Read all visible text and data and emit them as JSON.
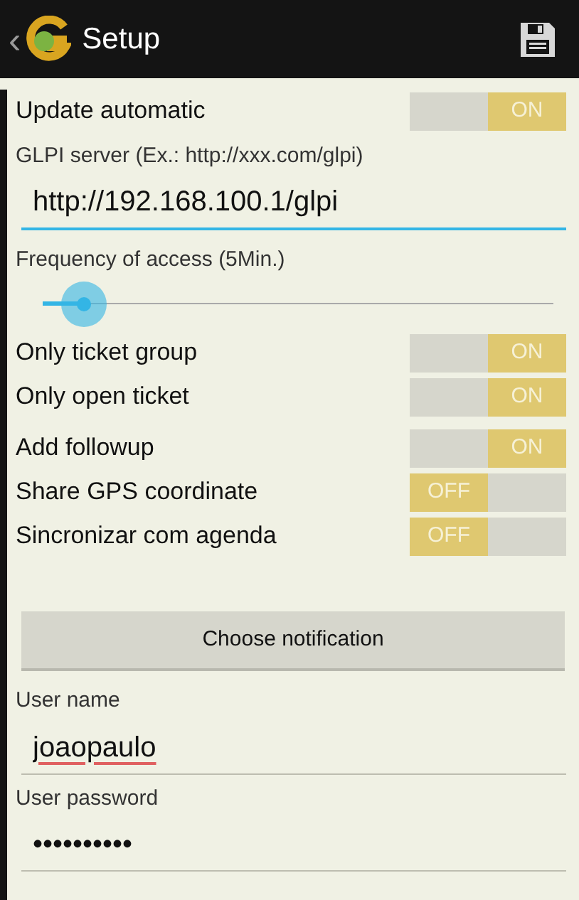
{
  "action_bar": {
    "back": "‹",
    "title": "Setup"
  },
  "settings": [
    {
      "kind": "toggle",
      "label": "Update automatic",
      "on": true,
      "state_text": "ON"
    },
    {
      "kind": "text_field",
      "label": "GLPI server (Ex.: http://xxx.com/glpi)",
      "value": "http://192.168.100.1/glpi",
      "focused": true
    },
    {
      "kind": "slider",
      "label": "Frequency of access (5Min.)",
      "level": 0.08
    },
    {
      "kind": "toggle",
      "label": "Only ticket group",
      "on": true,
      "state_text": "ON"
    },
    {
      "kind": "toggle",
      "label": "Only open ticket",
      "on": true,
      "state_text": "ON"
    },
    {
      "kind": "toggle",
      "label": "Add followup",
      "on": true,
      "state_text": "ON"
    },
    {
      "kind": "toggle",
      "label": "Share GPS coordinate",
      "on": false,
      "state_text": "OFF"
    },
    {
      "kind": "toggle",
      "label": "Sincronizar com agenda",
      "on": false,
      "state_text": "OFF"
    },
    {
      "kind": "button",
      "label": "Choose notification"
    },
    {
      "kind": "text_field",
      "label": "User name",
      "value": "joaopaulo",
      "focused": false,
      "misspelled": true
    },
    {
      "kind": "text_field",
      "label": "User password",
      "value": "••••••••••",
      "focused": false
    }
  ]
}
